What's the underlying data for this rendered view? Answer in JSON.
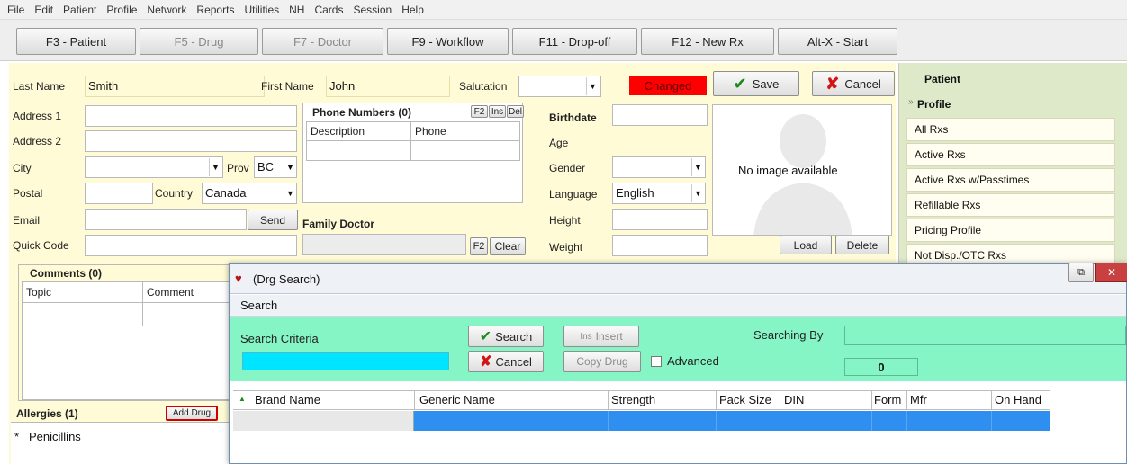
{
  "menu": [
    "File",
    "Edit",
    "Patient",
    "Profile",
    "Network",
    "Reports",
    "Utilities",
    "NH",
    "Cards",
    "Session",
    "Help"
  ],
  "toolbar": {
    "patient": "F3 - Patient",
    "drug": "F5 - Drug",
    "doctor": "F7 - Doctor",
    "workflow": "F9 - Workflow",
    "dropoff": "F11 - Drop-off",
    "newrx": "F12 - New Rx",
    "start": "Alt-X - Start"
  },
  "form": {
    "last_name_label": "Last Name",
    "last_name": "Smith",
    "first_name_label": "First Name",
    "first_name": "John",
    "salutation_label": "Salutation",
    "changed": "Changed",
    "save": "Save",
    "cancel": "Cancel",
    "address1": "Address 1",
    "address2": "Address 2",
    "city": "City",
    "prov_label": "Prov",
    "prov": "BC",
    "postal": "Postal",
    "country_label": "Country",
    "country": "Canada",
    "email": "Email",
    "send": "Send",
    "quick_code": "Quick Code",
    "phone_title": "Phone Numbers (0)",
    "phone_f2": "F2",
    "phone_ins": "Ins",
    "phone_del": "Del",
    "phone_desc": "Description",
    "phone_phone": "Phone",
    "family_doctor": "Family Doctor",
    "f2": "F2",
    "clear": "Clear",
    "birthdate": "Birthdate",
    "age": "Age",
    "gender": "Gender",
    "language_label": "Language",
    "language": "English",
    "height": "Height",
    "weight": "Weight",
    "no_image": "No image available",
    "load": "Load",
    "delete": "Delete",
    "comments_title": "Comments (0)",
    "topic": "Topic",
    "comment": "Comment",
    "allergies_title": "Allergies (1)",
    "add_drug": "Add Drug",
    "allergy_marker": "*",
    "allergy_item": "Penicillins"
  },
  "panel": {
    "header": "Patient",
    "section": "Profile",
    "items": [
      "All Rxs",
      "Active Rxs",
      "Active Rxs w/Passtimes",
      "Refillable Rxs",
      "Pricing Profile",
      "Not Disp./OTC Rxs"
    ]
  },
  "dialog": {
    "title": "(Drg Search)",
    "section": "Search",
    "criteria_label": "Search Criteria",
    "search_btn": "Search",
    "insert_btn": "Insert",
    "insert_key": "Ins",
    "cancel_btn": "Cancel",
    "copy_drug_btn": "Copy Drug",
    "advanced": "Advanced",
    "searching_by": "Searching By",
    "count": "0",
    "columns": [
      "Brand Name",
      "Generic Name",
      "Strength",
      "Pack Size",
      "DIN",
      "Form",
      "Mfr",
      "On Hand"
    ]
  },
  "colors": {
    "form_bg": "#fffbd6",
    "changed": "#ff0000",
    "panel_bg": "#dde9c9",
    "search_bg": "#85f5c5",
    "selection": "#2f8ff0"
  }
}
